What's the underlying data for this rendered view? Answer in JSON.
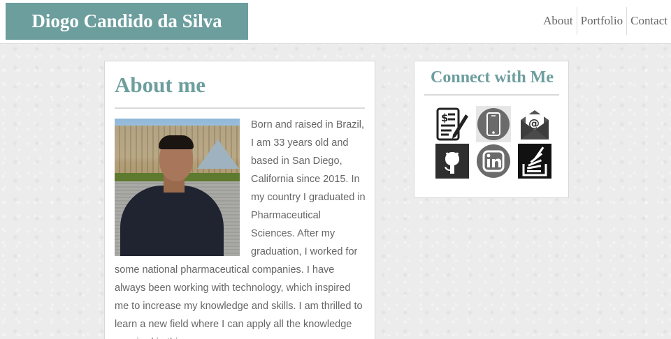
{
  "header": {
    "brand": "Diogo Candido da Silva",
    "nav": [
      "About",
      "Portfolio",
      "Contact"
    ]
  },
  "about": {
    "title": "About me",
    "body": "Born and raised in Brazil, I am 33 years old and based in San Diego, California since 2015. In my country I graduated in Pharmaceutical Sciences. After my graduation, I worked for some national pharmaceutical companies. I have always been working with technology, which inspired me to increase my knowledge and skills. I am thrilled to learn a new field where I can apply all the knowledge acquired in this program."
  },
  "connect": {
    "title": "Connect with Me",
    "icons": [
      "resume-icon",
      "phone-icon",
      "email-icon",
      "github-icon",
      "linkedin-icon",
      "stackoverflow-icon"
    ]
  },
  "colors": {
    "accent": "#6d9e9e",
    "text": "#666666"
  }
}
